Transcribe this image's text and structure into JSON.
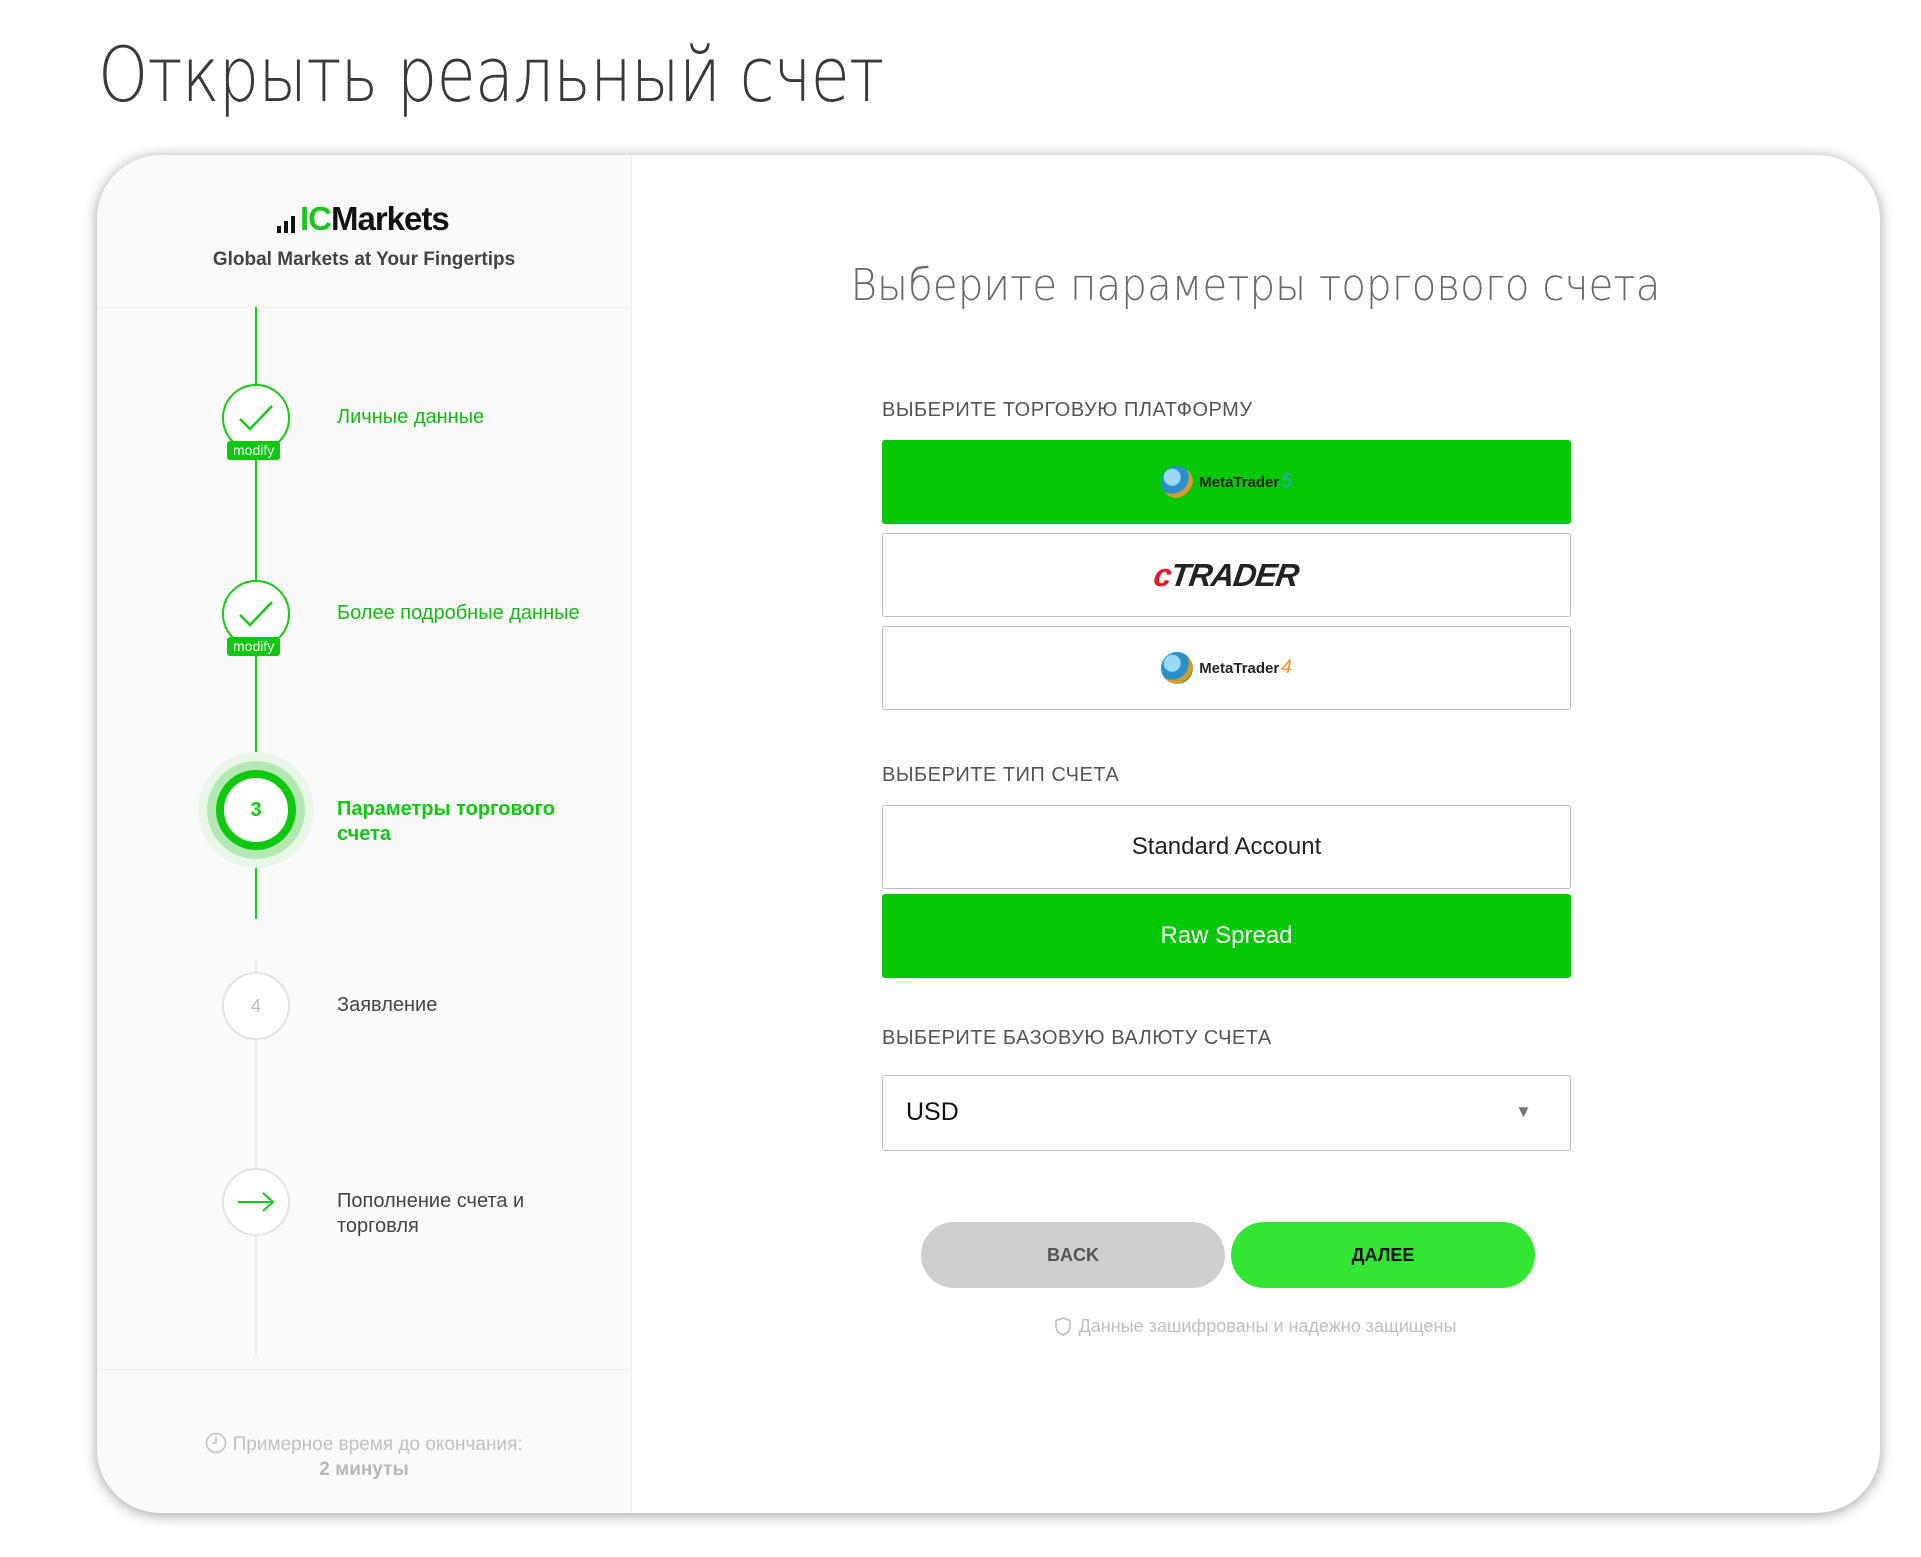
{
  "page": {
    "title": "Открыть реальный счет"
  },
  "brand": {
    "logo_ic": "IC",
    "logo_markets": "Markets",
    "tagline": "Global Markets at Your Fingertips"
  },
  "steps": [
    {
      "label": "Личные данные",
      "status": "done",
      "badge": "modify"
    },
    {
      "label": "Более подробные данные",
      "status": "done",
      "badge": "modify"
    },
    {
      "label": "Параметры торгового счета",
      "status": "current",
      "number": "3"
    },
    {
      "label": "Заявление",
      "status": "pending",
      "number": "4"
    },
    {
      "label": "Пополнение счета и торговля",
      "status": "pending",
      "icon": "arrow-right-icon"
    }
  ],
  "eta": {
    "label": "Примерное время до окончания:",
    "value": "2 минуты",
    "icon": "clock-icon"
  },
  "form": {
    "heading": "Выберите параметры торгового счета",
    "platform_label": "ВЫБЕРИТЕ ТОРГОВУЮ ПЛАТФОРМУ",
    "platforms": [
      {
        "name": "MetaTrader",
        "version": "5",
        "selected": true
      },
      {
        "name": "cTRADER",
        "selected": false
      },
      {
        "name": "MetaTrader",
        "version": "4",
        "selected": false
      }
    ],
    "account_type_label": "ВЫБЕРИТЕ ТИП СЧЕТА",
    "account_types": [
      {
        "label": "Standard Account",
        "selected": false
      },
      {
        "label": "Raw Spread",
        "selected": true
      }
    ],
    "currency_label": "ВЫБЕРИТЕ БАЗОВУЮ ВАЛЮТУ СЧЕТА",
    "currency_value": "USD",
    "back_label": "BACK",
    "next_label": "ДАЛЕЕ",
    "secure_note": "Данные зашифрованы и надежно защищены"
  },
  "colors": {
    "accent": "#06c806",
    "next_button": "#33e633",
    "back_button": "#cecece"
  }
}
